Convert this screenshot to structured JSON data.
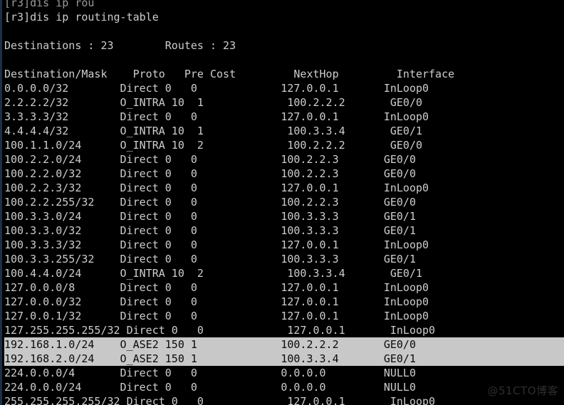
{
  "terminal": {
    "prompt_host": "[r3]",
    "colors": {
      "background": "#000000",
      "foreground": "#cdcdcd",
      "selection_background": "#c8c8c8",
      "selection_foreground": "#0a0a0a",
      "left_border": "#1c2f4a",
      "watermark": "#2e2e2e"
    },
    "scrollback_top_partial_line": "[r3]dis ip rou",
    "command_line": "[r3]dis ip routing-table",
    "summary": {
      "destinations_label": "Destinations",
      "destinations_value": "23",
      "routes_label": "Routes",
      "routes_value": "23",
      "text": "Destinations : 23        Routes : 23"
    },
    "table": {
      "columns": [
        {
          "key": "destination_mask",
          "header": "Destination/Mask",
          "width": 18
        },
        {
          "key": "proto",
          "header": "Proto",
          "width": 7
        },
        {
          "key": "pre",
          "header": "Pre",
          "width": 4
        },
        {
          "key": "cost",
          "header": "Cost",
          "width": 14
        },
        {
          "key": "nexthop",
          "header": "NextHop",
          "width": 16
        },
        {
          "key": "interface",
          "header": "Interface",
          "width": 10
        }
      ],
      "header_text": "Destination/Mask    Proto   Pre Cost         NextHop         Interface",
      "rows": [
        {
          "destination_mask": "0.0.0.0/32",
          "proto": "Direct",
          "pre": "0",
          "cost": "0",
          "nexthop": "127.0.0.1",
          "interface": "InLoop0",
          "selected": false
        },
        {
          "destination_mask": "2.2.2.2/32",
          "proto": "O_INTRA",
          "pre": "10",
          "cost": "1",
          "nexthop": "100.2.2.2",
          "interface": "GE0/0",
          "selected": false
        },
        {
          "destination_mask": "3.3.3.3/32",
          "proto": "Direct",
          "pre": "0",
          "cost": "0",
          "nexthop": "127.0.0.1",
          "interface": "InLoop0",
          "selected": false
        },
        {
          "destination_mask": "4.4.4.4/32",
          "proto": "O_INTRA",
          "pre": "10",
          "cost": "1",
          "nexthop": "100.3.3.4",
          "interface": "GE0/1",
          "selected": false
        },
        {
          "destination_mask": "100.1.1.0/24",
          "proto": "O_INTRA",
          "pre": "10",
          "cost": "2",
          "nexthop": "100.2.2.2",
          "interface": "GE0/0",
          "selected": false
        },
        {
          "destination_mask": "100.2.2.0/24",
          "proto": "Direct",
          "pre": "0",
          "cost": "0",
          "nexthop": "100.2.2.3",
          "interface": "GE0/0",
          "selected": false
        },
        {
          "destination_mask": "100.2.2.0/32",
          "proto": "Direct",
          "pre": "0",
          "cost": "0",
          "nexthop": "100.2.2.3",
          "interface": "GE0/0",
          "selected": false
        },
        {
          "destination_mask": "100.2.2.3/32",
          "proto": "Direct",
          "pre": "0",
          "cost": "0",
          "nexthop": "127.0.0.1",
          "interface": "InLoop0",
          "selected": false
        },
        {
          "destination_mask": "100.2.2.255/32",
          "proto": "Direct",
          "pre": "0",
          "cost": "0",
          "nexthop": "100.2.2.3",
          "interface": "GE0/0",
          "selected": false
        },
        {
          "destination_mask": "100.3.3.0/24",
          "proto": "Direct",
          "pre": "0",
          "cost": "0",
          "nexthop": "100.3.3.3",
          "interface": "GE0/1",
          "selected": false
        },
        {
          "destination_mask": "100.3.3.0/32",
          "proto": "Direct",
          "pre": "0",
          "cost": "0",
          "nexthop": "100.3.3.3",
          "interface": "GE0/1",
          "selected": false
        },
        {
          "destination_mask": "100.3.3.3/32",
          "proto": "Direct",
          "pre": "0",
          "cost": "0",
          "nexthop": "127.0.0.1",
          "interface": "InLoop0",
          "selected": false
        },
        {
          "destination_mask": "100.3.3.255/32",
          "proto": "Direct",
          "pre": "0",
          "cost": "0",
          "nexthop": "100.3.3.3",
          "interface": "GE0/1",
          "selected": false
        },
        {
          "destination_mask": "100.4.4.0/24",
          "proto": "O_INTRA",
          "pre": "10",
          "cost": "2",
          "nexthop": "100.3.3.4",
          "interface": "GE0/1",
          "selected": false
        },
        {
          "destination_mask": "127.0.0.0/8",
          "proto": "Direct",
          "pre": "0",
          "cost": "0",
          "nexthop": "127.0.0.1",
          "interface": "InLoop0",
          "selected": false
        },
        {
          "destination_mask": "127.0.0.0/32",
          "proto": "Direct",
          "pre": "0",
          "cost": "0",
          "nexthop": "127.0.0.1",
          "interface": "InLoop0",
          "selected": false
        },
        {
          "destination_mask": "127.0.0.1/32",
          "proto": "Direct",
          "pre": "0",
          "cost": "0",
          "nexthop": "127.0.0.1",
          "interface": "InLoop0",
          "selected": false
        },
        {
          "destination_mask": "127.255.255.255/32",
          "proto": "Direct",
          "pre": "0",
          "cost": "0",
          "nexthop": "127.0.0.1",
          "interface": "InLoop0",
          "selected": false
        },
        {
          "destination_mask": "192.168.1.0/24",
          "proto": "O_ASE2",
          "pre": "150",
          "cost": "1",
          "nexthop": "100.2.2.2",
          "interface": "GE0/0",
          "selected": true
        },
        {
          "destination_mask": "192.168.2.0/24",
          "proto": "O_ASE2",
          "pre": "150",
          "cost": "1",
          "nexthop": "100.3.3.4",
          "interface": "GE0/1",
          "selected": true
        },
        {
          "destination_mask": "224.0.0.0/4",
          "proto": "Direct",
          "pre": "0",
          "cost": "0",
          "nexthop": "0.0.0.0",
          "interface": "NULL0",
          "selected": false
        },
        {
          "destination_mask": "224.0.0.0/24",
          "proto": "Direct",
          "pre": "0",
          "cost": "0",
          "nexthop": "0.0.0.0",
          "interface": "NULL0",
          "selected": false
        },
        {
          "destination_mask": "255.255.255.255/32",
          "proto": "Direct",
          "pre": "0",
          "cost": "0",
          "nexthop": "127.0.0.1",
          "interface": "InLoop0",
          "selected": false
        }
      ]
    },
    "watermark": "@51CTO博客"
  }
}
